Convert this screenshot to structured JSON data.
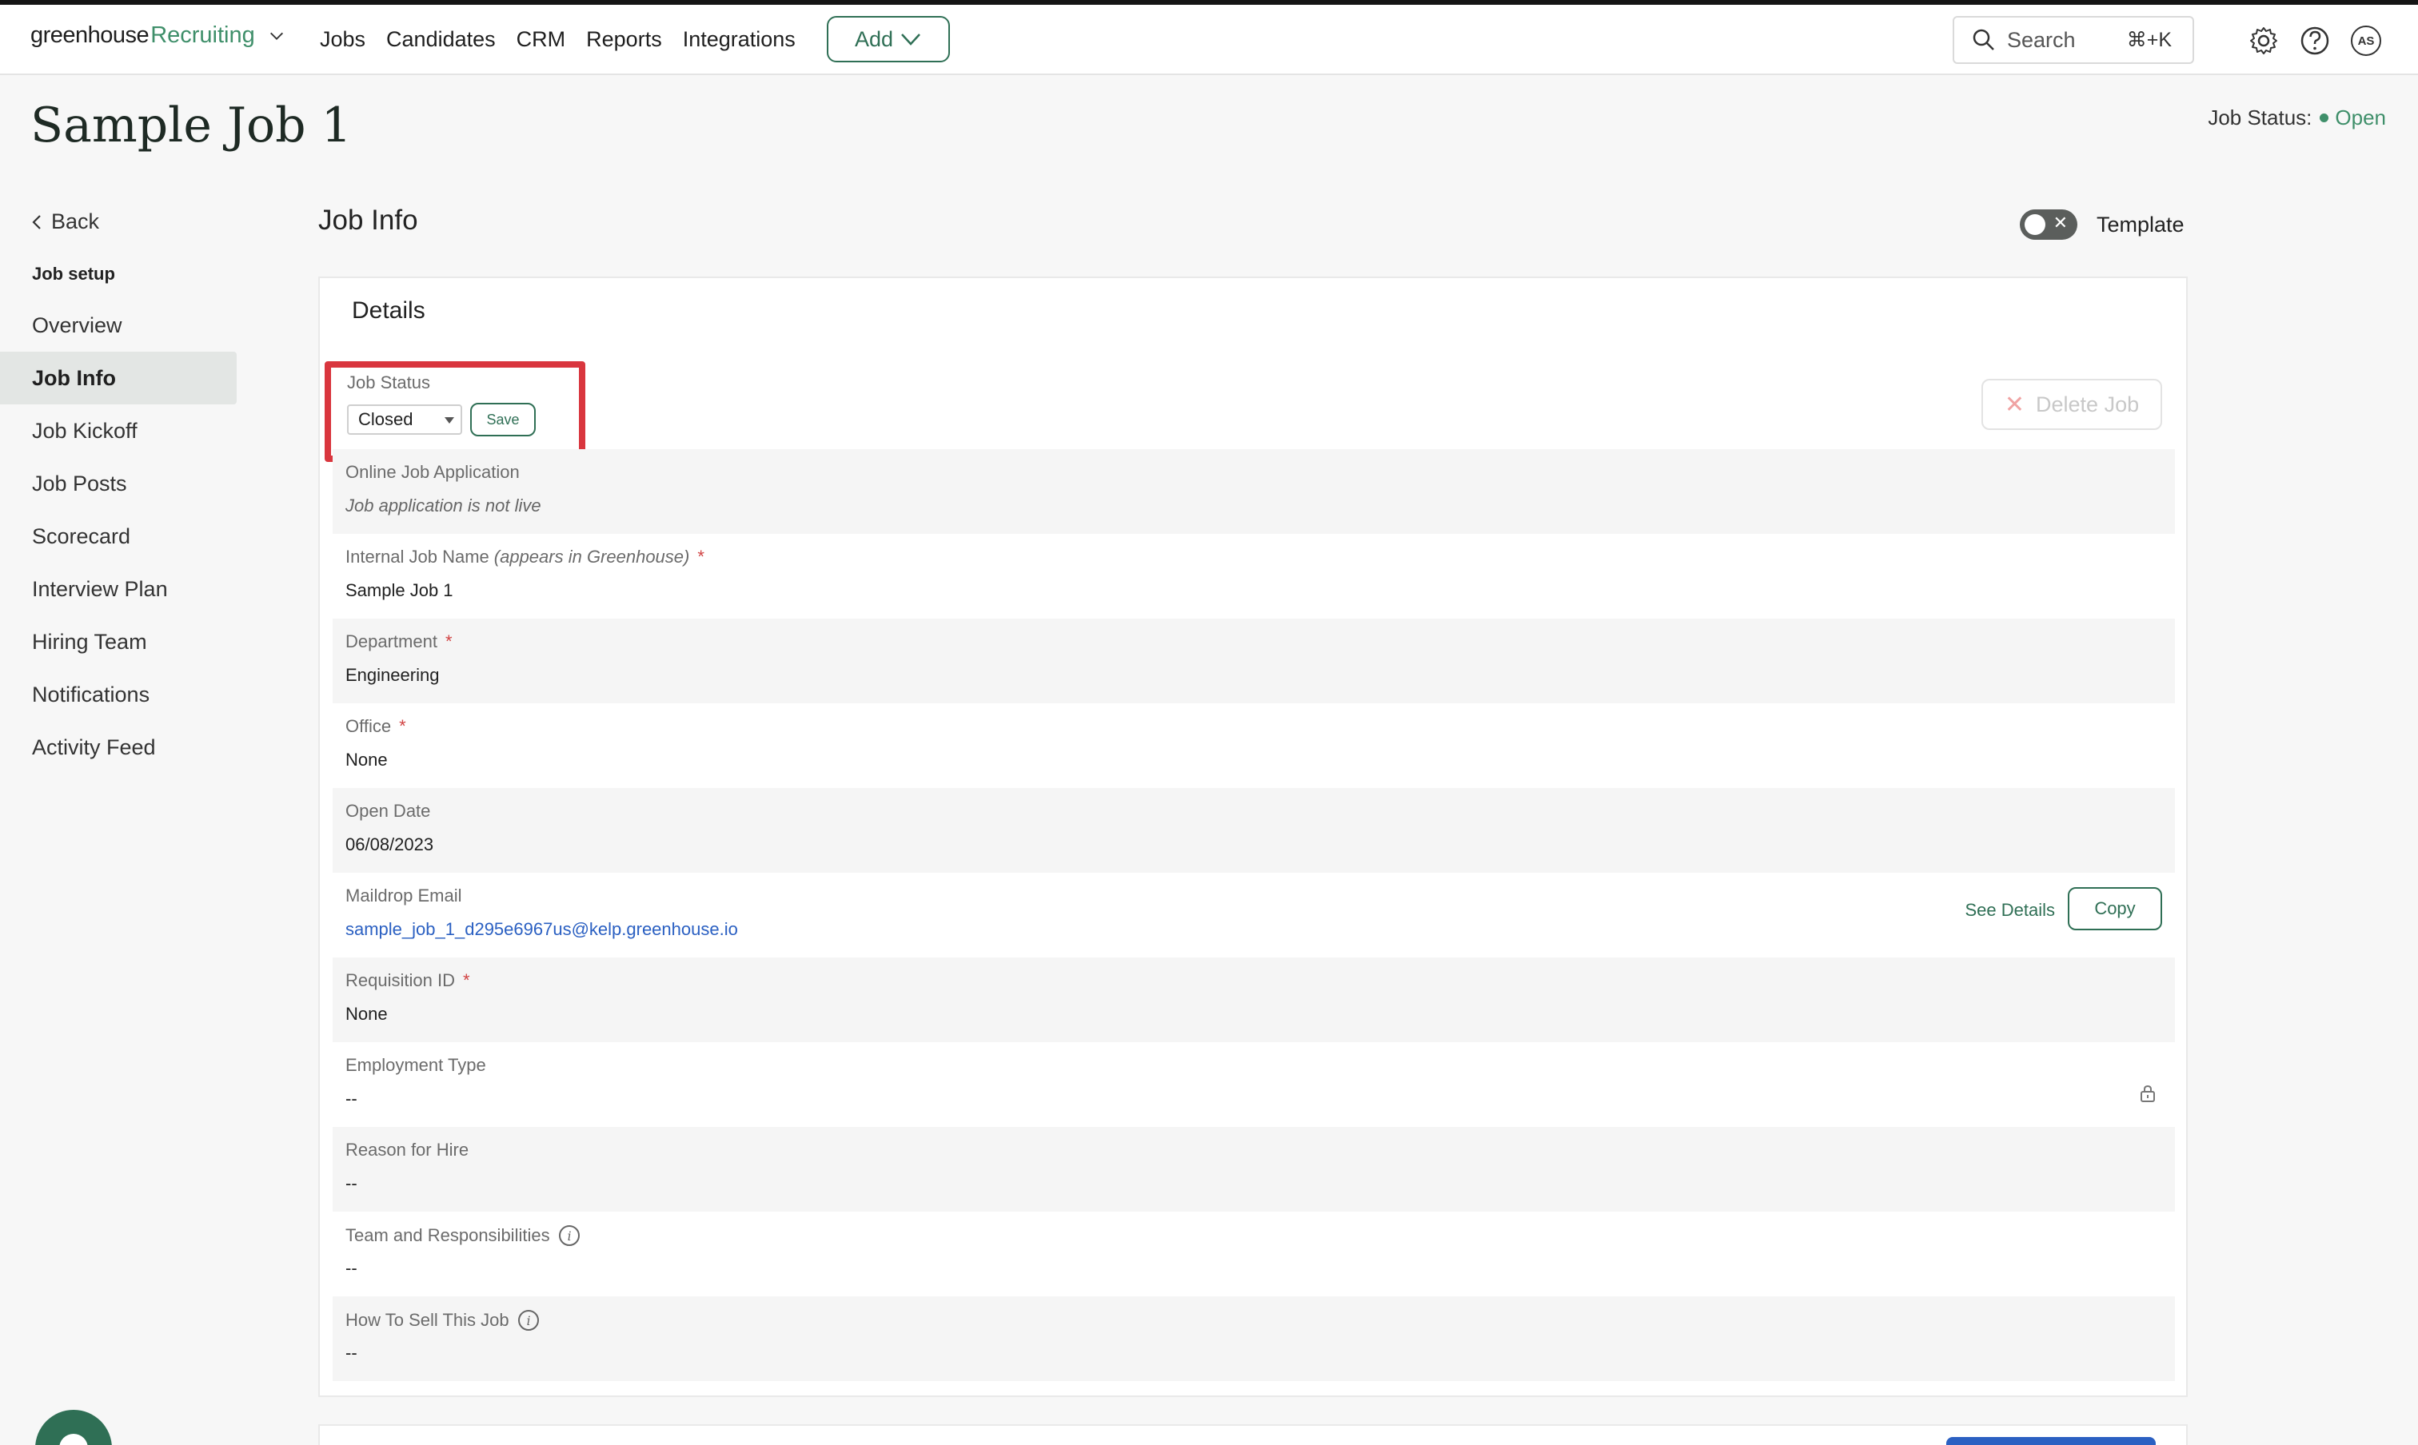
{
  "header": {
    "logo_part1": "greenhouse",
    "logo_part2": "Recruiting",
    "nav": [
      "Jobs",
      "Candidates",
      "CRM",
      "Reports",
      "Integrations"
    ],
    "add_label": "Add",
    "search_label": "Search",
    "search_shortcut": "⌘+K",
    "avatar_initials": "AS"
  },
  "page": {
    "title": "Sample Job 1",
    "job_status_label": "Job Status:",
    "job_status_value": "Open"
  },
  "sidebar": {
    "back_label": "Back",
    "heading": "Job setup",
    "items": [
      {
        "label": "Overview",
        "active": false
      },
      {
        "label": "Job Info",
        "active": true
      },
      {
        "label": "Job Kickoff",
        "active": false
      },
      {
        "label": "Job Posts",
        "active": false
      },
      {
        "label": "Scorecard",
        "active": false
      },
      {
        "label": "Interview Plan",
        "active": false
      },
      {
        "label": "Hiring Team",
        "active": false
      },
      {
        "label": "Notifications",
        "active": false
      },
      {
        "label": "Activity Feed",
        "active": false
      }
    ]
  },
  "main": {
    "section_title": "Job Info",
    "template_label": "Template",
    "card_title": "Details",
    "job_status": {
      "label": "Job Status",
      "selected": "Closed",
      "save_label": "Save"
    },
    "delete_label": "Delete Job",
    "fields": [
      {
        "label": "Online Job Application",
        "value": "Job application is not live"
      },
      {
        "label": "Internal Job Name",
        "label_note": "(appears in Greenhouse)",
        "required": "*",
        "value": "Sample Job 1"
      },
      {
        "label": "Department",
        "required": "*",
        "value": "Engineering"
      },
      {
        "label": "Office",
        "required": "*",
        "value": "None"
      },
      {
        "label": "Open Date",
        "value": "06/08/2023"
      },
      {
        "label": "Maildrop Email",
        "value": "sample_job_1_d295e6967us@kelp.greenhouse.io",
        "see_details": "See Details",
        "copy": "Copy"
      },
      {
        "label": "Requisition ID",
        "required": "*",
        "value": "None"
      },
      {
        "label": "Employment Type",
        "value": "--"
      },
      {
        "label": "Reason for Hire",
        "value": "--"
      },
      {
        "label": "Team and Responsibilities",
        "value": "--"
      },
      {
        "label": "How To Sell This Job",
        "value": "--"
      }
    ]
  },
  "colors": {
    "brand_green": "#3f8f6a",
    "highlight_red": "#d9363e",
    "link_blue": "#2b60c2"
  }
}
